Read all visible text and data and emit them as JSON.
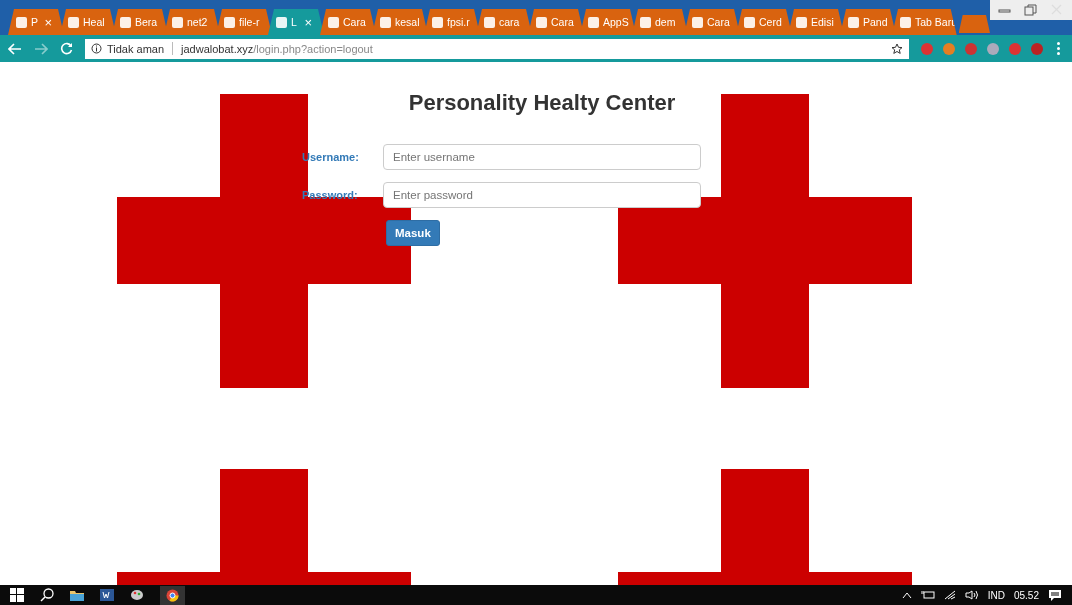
{
  "tabs": [
    {
      "title": "P",
      "selected": false,
      "close": "×"
    },
    {
      "title": "Heal",
      "selected": false
    },
    {
      "title": "Bera",
      "selected": false
    },
    {
      "title": "net2",
      "selected": false
    },
    {
      "title": "file-r",
      "selected": false
    },
    {
      "title": "L",
      "selected": true,
      "close": "×"
    },
    {
      "title": "Cara",
      "selected": false
    },
    {
      "title": "kesal",
      "selected": false
    },
    {
      "title": "fpsi.r",
      "selected": false
    },
    {
      "title": "cara",
      "selected": false
    },
    {
      "title": "Cara",
      "selected": false
    },
    {
      "title": "AppS",
      "selected": false
    },
    {
      "title": "dem",
      "selected": false
    },
    {
      "title": "Cara",
      "selected": false
    },
    {
      "title": "Cerd",
      "selected": false
    },
    {
      "title": "Edisi",
      "selected": false
    },
    {
      "title": "Pand",
      "selected": false
    },
    {
      "title": "Tab Baru",
      "selected": false
    }
  ],
  "address_bar": {
    "security": "Tidak aman",
    "host": "jadwalobat.xyz",
    "path": "/login.php?action=logout"
  },
  "page": {
    "title": "Personality Healty Center",
    "fields": [
      {
        "label": "Username:",
        "placeholder": "Enter username"
      },
      {
        "label": "Password:",
        "placeholder": "Enter password"
      }
    ],
    "submit": "Masuk"
  },
  "taskbar": {
    "language": "IND",
    "time": "05.52"
  }
}
